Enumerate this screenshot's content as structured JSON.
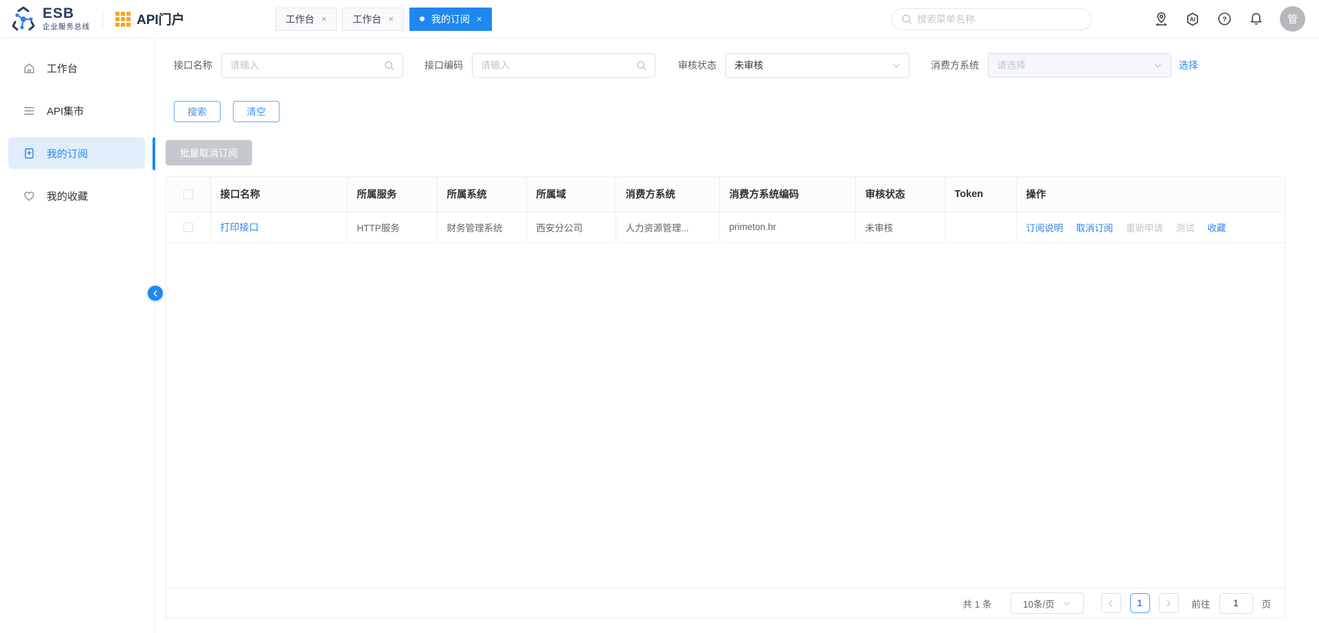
{
  "header": {
    "logo_title": "ESB",
    "logo_subtitle": "企业服务总线",
    "portal_title": "API门户",
    "tabs": [
      {
        "label": "工作台",
        "active": false
      },
      {
        "label": "工作台",
        "active": false
      },
      {
        "label": "我的订阅",
        "active": true
      }
    ],
    "menu_search_placeholder": "搜索菜单名称",
    "avatar_text": "管"
  },
  "icons": {
    "close": "×"
  },
  "sidebar": {
    "items": [
      {
        "label": "工作台"
      },
      {
        "label": "API集市"
      },
      {
        "label": "我的订阅",
        "active": true
      },
      {
        "label": "我的收藏"
      }
    ]
  },
  "filters": {
    "interface_name": {
      "label": "接口名称",
      "placeholder": "请输入"
    },
    "interface_code": {
      "label": "接口编码",
      "placeholder": "请输入"
    },
    "audit_status": {
      "label": "审核状态",
      "value": "未审核"
    },
    "consumer_system": {
      "label": "消费方系统",
      "placeholder": "请选择",
      "link_label": "选择"
    },
    "search_button": "搜索",
    "clear_button": "清空"
  },
  "toolbar": {
    "batch_unsubscribe_button": "批量取消订阅"
  },
  "table": {
    "columns": [
      "接口名称",
      "所属服务",
      "所属系统",
      "所属域",
      "消费方系统",
      "消费方系统编码",
      "审核状态",
      "Token",
      "操作"
    ],
    "rows": [
      {
        "name": "打印接口",
        "service": "HTTP服务",
        "system": "财务管理系统",
        "domain": "西安分公司",
        "consumer": "人力资源管理...",
        "consumer_code": "primeton.hr",
        "status": "未审核",
        "token": "",
        "actions": [
          {
            "label": "订阅说明",
            "enabled": true
          },
          {
            "label": "取消订阅",
            "enabled": true
          },
          {
            "label": "重新申请",
            "enabled": false
          },
          {
            "label": "测试",
            "enabled": false
          },
          {
            "label": "收藏",
            "enabled": true
          }
        ]
      }
    ]
  },
  "pagination": {
    "total_text": "共 1 条",
    "page_size": "10条/页",
    "current_page": "1",
    "goto_label": "前往",
    "goto_value": "1",
    "page_suffix": "页"
  },
  "colors": {
    "primary": "#1f87f0",
    "link": "#2b85f2",
    "brand_navy": "#273b5e",
    "brand_orange": "#f5a623",
    "disabled_text": "#c0c4cc",
    "disabled_button_bg": "#c4c8cf",
    "sidebar_active_bg": "#e2edfb",
    "border": "#ebeef5"
  }
}
